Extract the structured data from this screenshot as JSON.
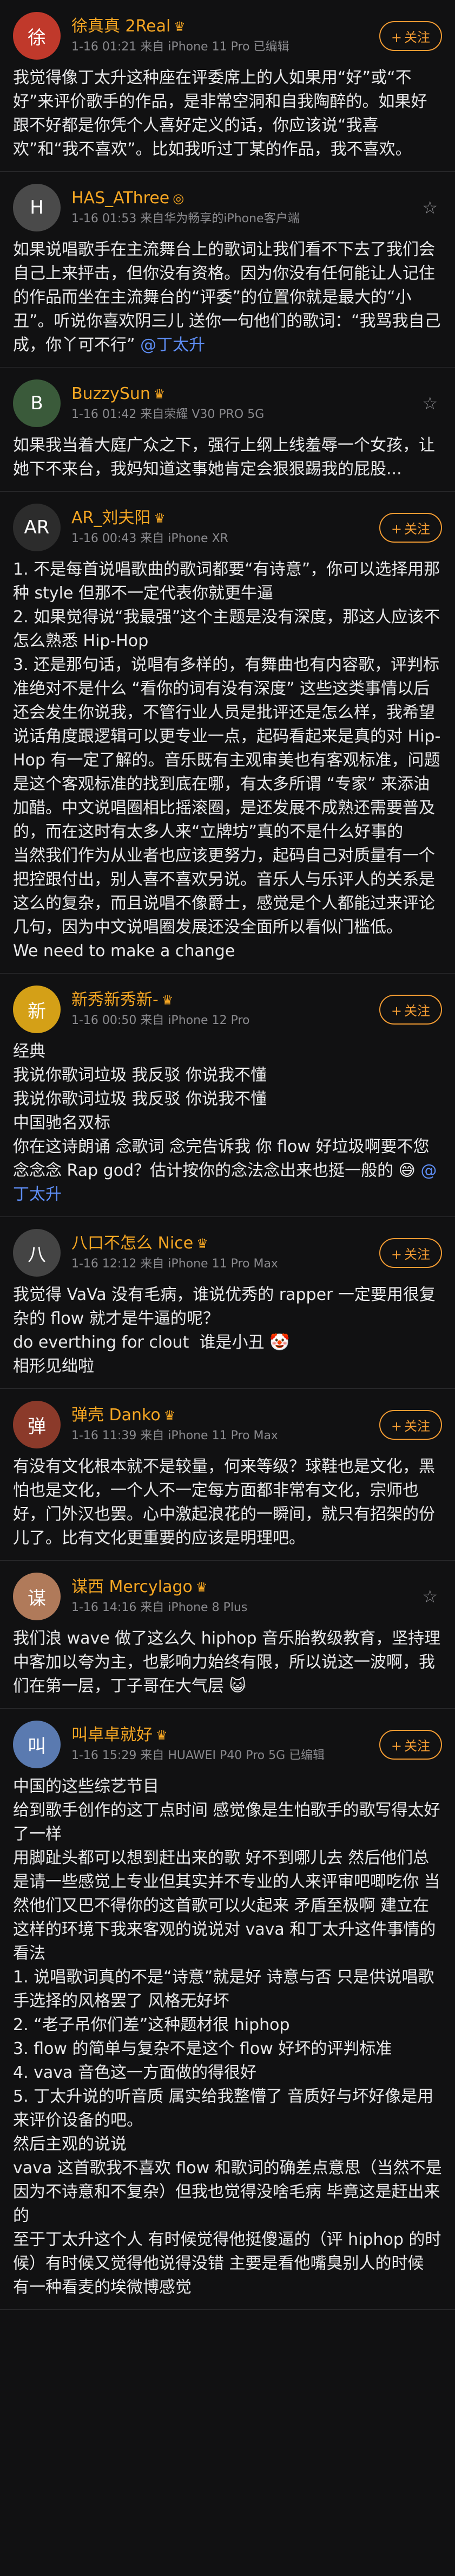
{
  "comments": [
    {
      "name": "徐真真 2Real",
      "badge": "♛",
      "time": "1-16 01:21",
      "source": "来自 iPhone 11 Pro",
      "edited": "已编辑",
      "action": "关注",
      "avatar": "徐",
      "avatar_color": "#c0392b",
      "text": "我觉得像丁太升这种座在评委席上的人如果用“好”或“不好”来评价歌手的作品，是非常空洞和自我陶醉的。如果好跟不好都是你凭个人喜好定义的话，你应该说“我喜欢”和“我不喜欢”。比如我听过丁某的作品，我不喜欢。",
      "mention": ""
    },
    {
      "name": "HAS_AThree",
      "badge": "◎",
      "time": "1-16 01:53",
      "source": "来自华为畅享的iPhone客户端",
      "edited": "",
      "action": "",
      "avatar": "H",
      "avatar_color": "#4a4a4a",
      "text": "如果说唱歌手在主流舞台上的歌词让我们看不下去了我们会自己上来抨击，但你没有资格。因为你没有任何能让人记住的作品而坐在主流舞台的“评委”的位置你就是最大的“小丑”。听说你喜欢阴三儿 送你一句他们的歌词：“我骂我自己成，你丫可不行”",
      "mention": "@丁太升"
    },
    {
      "name": "BuzzySun",
      "badge": "♛",
      "time": "1-16 01:42",
      "source": "来自荣耀 V30 PRO 5G",
      "edited": "",
      "action": "",
      "avatar": "B",
      "avatar_color": "#3a5a3a",
      "text": "如果我当着大庭广众之下，强行上纲上线羞辱一个女孩，让她下不来台，我妈知道这事她肯定会狠狠踢我的屁股...",
      "mention": ""
    },
    {
      "name": "AR_刘夫阳",
      "badge": "♛",
      "time": "1-16 00:43",
      "source": "来自 iPhone XR",
      "edited": "",
      "action": "关注",
      "avatar": "AR",
      "avatar_color": "#2c2c2c",
      "text": "1. 不是每首说唱歌曲的歌词都要“有诗意”，你可以选择用那种 style 但那不一定代表你就更牛逼\n2. 如果觉得说“我最强”这个主题是没有深度，那这人应该不怎么熟悉 Hip-Hop\n3. 还是那句话，说唱有多样的，有舞曲也有内容歌，评判标准绝对不是什么 “看你的词有没有深度” 这些这类事情以后还会发生你说我，不管行业人员是批评还是怎么样，我希望说话角度跟逻辑可以更专业一点，起码看起来是真的对 Hip-Hop 有一定了解的。音乐既有主观审美也有客观标准，问题是这个客观标准的找到底在哪，有太多所谓 “专家” 来添油加醋。中文说唱圈相比摇滚圈，是还发展不成熟还需要普及的，而在这时有太多人来“立牌坊”真的不是什么好事的\n当然我们作为从业者也应该更努力，起码自己对质量有一个把控跟付出，别人喜不喜欢另说。音乐人与乐评人的关系是这么的复杂，而且说唱不像爵士，感觉是个人都能过来评论几句，因为中文说唱圈发展还没全面所以看似门槛低。\nWe need to make a change",
      "mention": ""
    },
    {
      "name": "新秀新秀新-",
      "badge": "♛",
      "time": "1-16 00:50",
      "source": "来自 iPhone 12 Pro",
      "edited": "",
      "action": "关注",
      "avatar": "新",
      "avatar_color": "#d4a017",
      "text": "经典\n我说你歌词垃圾 我反驳 你说我不懂\n我说你歌词垃圾 我反驳 你说我不懂\n中国驰名双标\n你在这诗朗诵 念歌词 念完告诉我 你 flow 好垃圾啊要不您念念念 Rap god？估计按你的念法念出来也挺一般的 😅",
      "mention": "@丁太升"
    },
    {
      "name": "八口不怎么 Nice",
      "badge": "♛",
      "time": "1-16 12:12",
      "source": "来自 iPhone 11 Pro Max",
      "edited": "",
      "action": "关注",
      "avatar": "八",
      "avatar_color": "#444",
      "text": "我觉得 VaVa 没有毛病，谁说优秀的 rapper 一定要用很复杂的 flow 就才是牛逼的呢？\ndo everthing for clout  谁是小丑 🤡\n相形见绌啦",
      "mention": ""
    },
    {
      "name": "弹壳 Danko",
      "badge": "♛",
      "time": "1-16 11:39",
      "source": "来自 iPhone 11 Pro Max",
      "edited": "",
      "action": "关注",
      "avatar": "弹",
      "avatar_color": "#8b3a2a",
      "text": "有没有文化根本就不是较量，何来等级？球鞋也是文化，黑怕也是文化，一个人不一定每方面都非常有文化，宗师也好，门外汉也罢。心中激起浪花的一瞬间，就只有招架的份儿了。比有文化更重要的应该是明理吧。",
      "mention": ""
    },
    {
      "name": "谋西 Mercylago",
      "badge": "♛",
      "time": "1-16 14:16",
      "source": "来自 iPhone 8 Plus",
      "edited": "",
      "action": "",
      "avatar": "谋",
      "avatar_color": "#b07a5a",
      "text": "我们浪 wave 做了这么久 hiphop 音乐胎教级教育，坚持理中客加以夸为主，也影响力始终有限，所以说这一波啊，我们在第一层，丁子哥在大气层 😺",
      "mention": ""
    },
    {
      "name": "叫卓卓就好",
      "badge": "♛",
      "time": "1-16 15:29",
      "source": "来自 HUAWEI P40 Pro 5G",
      "edited": "已编辑",
      "action": "关注",
      "avatar": "叫",
      "avatar_color": "#5a7ab0",
      "text": "中国的这些综艺节目\n给到歌手创作的这丁点时间 感觉像是生怕歌手的歌写得太好了一样\n用脚趾头都可以想到赶出来的歌 好不到哪儿去 然后他们总是请一些感觉上专业但其实并不专业的人来评审吧唧吃你 当然他们又巴不得你的这首歌可以火起来 矛盾至极啊 建立在这样的环境下我来客观的说说对 vava 和丁太升这件事情的看法\n1. 说唱歌词真的不是“诗意”就是好 诗意与否 只是供说唱歌手选择的风格罢了 风格无好坏\n2. “老子吊你们差”这种题材很 hiphop\n3. flow 的简单与复杂不是这个 flow 好坏的评判标准\n4. vava 音色这一方面做的得很好\n5. 丁太升说的听音质 属实给我整懵了 音质好与坏好像是用来评价设备的吧。\n然后主观的说说\nvava 这首歌我不喜欢 flow 和歌词的确差点意思（当然不是因为不诗意和不复杂）但我也觉得没啥毛病 毕竟这是赶出来的\n至于丁太升这个人 有时候觉得他挺傻逼的（评 hiphop 的时候）有时候又觉得他说得没错 主要是看他嘴臭别人的时候 有一种看麦的埃微博感觉",
      "mention": ""
    }
  ]
}
